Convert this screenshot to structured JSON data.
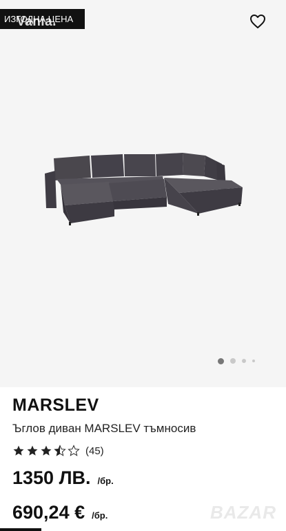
{
  "badge": {
    "label": "ИЗГОДНА ЦЕНА",
    "overlay": "Vania."
  },
  "product": {
    "brand": "MARSLEV",
    "description": "Ъглов диван MARSLEV тъмносив",
    "rating": 3.5,
    "rating_count": "(45)",
    "price_primary": "1350 ЛВ.",
    "price_primary_unit": "/бр.",
    "price_secondary": "690,24 €",
    "price_secondary_unit": "/бр."
  },
  "carousel": {
    "total": 4,
    "active_index": 0
  },
  "watermark": "BAZAR",
  "icons": {
    "favorite": "heart-outline-icon",
    "star": "star-icon"
  },
  "colors": {
    "badge_bg": "#111111",
    "star": "#222222",
    "hero_bg": "#f5f5f5"
  }
}
